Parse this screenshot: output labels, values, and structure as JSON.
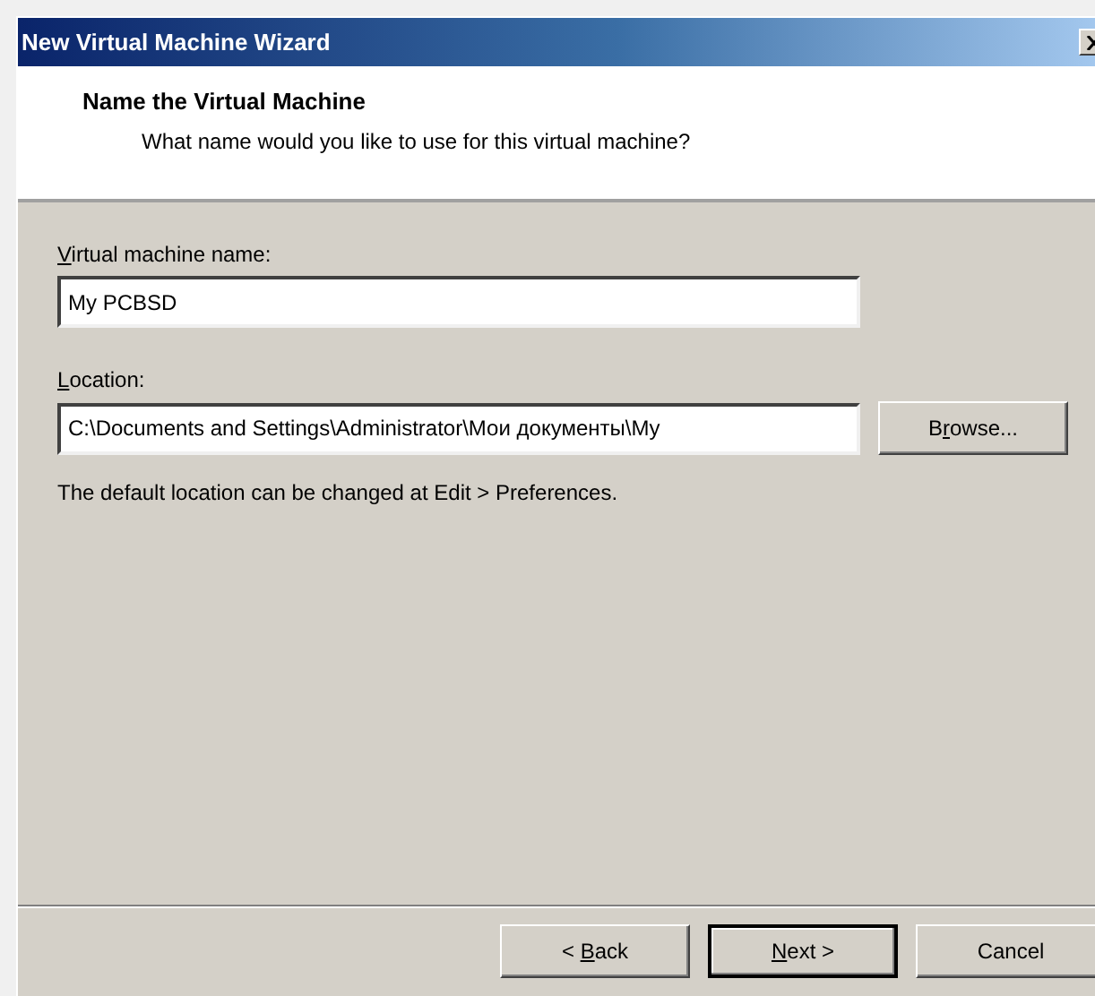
{
  "window": {
    "title": "New Virtual Machine Wizard"
  },
  "header": {
    "title": "Name the Virtual Machine",
    "subtitle": "What name would you like to use for this virtual machine?"
  },
  "fields": [
    {
      "label_parts": [
        {
          "text": "V",
          "underlined": true
        },
        {
          "text": "irtual machine name:",
          "underlined": false
        }
      ],
      "value": "My PCBSD"
    },
    {
      "label_parts": [
        {
          "text": "L",
          "underlined": true
        },
        {
          "text": "ocation:",
          "underlined": false
        }
      ],
      "value": "C:\\Documents and Settings\\Administrator\\Мои документы\\My",
      "button": {
        "label_parts": [
          {
            "text": "B",
            "underlined": false
          },
          {
            "text": "r",
            "underlined": true
          },
          {
            "text": "owse...",
            "underlined": false
          }
        ]
      }
    }
  ],
  "hint": "The default location can be changed at Edit > Preferences.",
  "buttons": [
    {
      "label_parts": [
        {
          "text": "< ",
          "underlined": false
        },
        {
          "text": "B",
          "underlined": true
        },
        {
          "text": "ack",
          "underlined": false
        }
      ],
      "default": false
    },
    {
      "label_parts": [
        {
          "text": "N",
          "underlined": true
        },
        {
          "text": "ext >",
          "underlined": false
        }
      ],
      "default": true
    },
    {
      "label_parts": [
        {
          "text": "Cancel",
          "underlined": false
        }
      ],
      "default": false
    }
  ]
}
